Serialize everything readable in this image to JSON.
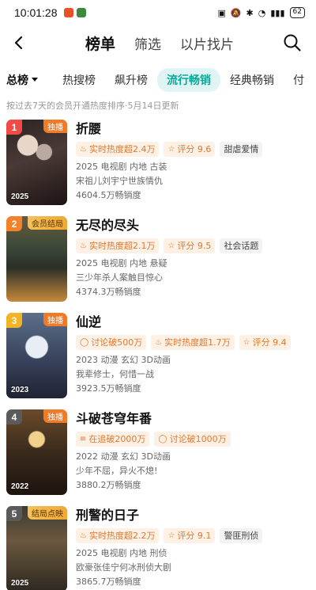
{
  "status": {
    "time": "10:01:28",
    "battery": "62"
  },
  "nav": {
    "tabs": [
      "榜单",
      "筛选",
      "以片找片"
    ],
    "active_index": 0
  },
  "categories": {
    "dropdown_label": "总榜",
    "items": [
      "热搜榜",
      "飙升榜",
      "流行畅销",
      "经典畅销",
      "付"
    ],
    "active_index": 2
  },
  "subtitle": "按过去7天的会员开通热度排序·5月14日更新",
  "items": [
    {
      "rank": "1",
      "badge": "独播",
      "year": "2025",
      "title": "折腰",
      "tags": [
        {
          "text": "实时热度超2.4万",
          "type": "hot",
          "icon": "flame-icon"
        },
        {
          "text": "评分 9.6",
          "type": "hot",
          "icon": "star-icon"
        },
        {
          "text": "甜虐爱情",
          "type": "plain",
          "icon": ""
        }
      ],
      "meta": "2025 电视剧 内地 古装",
      "desc": "宋祖儿刘宇宁世族情仇",
      "sales": "4604.5万畅销度"
    },
    {
      "rank": "2",
      "badge": "会员结局",
      "year": "",
      "title": "无尽的尽头",
      "tags": [
        {
          "text": "实时热度超2.1万",
          "type": "hot",
          "icon": "flame-icon"
        },
        {
          "text": "评分 9.5",
          "type": "hot",
          "icon": "star-icon"
        },
        {
          "text": "社会话题",
          "type": "plain",
          "icon": ""
        }
      ],
      "meta": "2025 电视剧 内地 悬疑",
      "desc": "三少年杀人案触目惊心",
      "sales": "4374.3万畅销度"
    },
    {
      "rank": "3",
      "badge": "独播",
      "year": "2023",
      "title": "仙逆",
      "tags": [
        {
          "text": "讨论破500万",
          "type": "hot",
          "icon": "chat-icon"
        },
        {
          "text": "实时热度超1.7万",
          "type": "hot",
          "icon": "flame-icon"
        },
        {
          "text": "评分 9.4",
          "type": "hot",
          "icon": "star-icon"
        }
      ],
      "meta": "2023 动漫 玄幻 3D动画",
      "desc": "我辈修士，何惜一战",
      "sales": "3923.5万畅销度"
    },
    {
      "rank": "4",
      "badge": "独播",
      "year": "2022",
      "title": "斗破苍穹年番",
      "tags": [
        {
          "text": "在追破2000万",
          "type": "hot",
          "icon": "list-icon"
        },
        {
          "text": "讨论破1000万",
          "type": "hot",
          "icon": "chat-icon"
        }
      ],
      "meta": "2022 动漫 玄幻 3D动画",
      "desc": "少年不屈，异火不熄!",
      "sales": "3880.2万畅销度"
    },
    {
      "rank": "5",
      "badge": "结局点映",
      "year": "2025",
      "title": "刑警的日子",
      "tags": [
        {
          "text": "实时热度超2.2万",
          "type": "hot",
          "icon": "flame-icon"
        },
        {
          "text": "评分 9.1",
          "type": "hot",
          "icon": "star-icon"
        },
        {
          "text": "警匪刑侦",
          "type": "plain",
          "icon": ""
        }
      ],
      "meta": "2025 电视剧 内地 刑侦",
      "desc": "欧豪张佳宁何冰刑侦大剧",
      "sales": "3865.7万畅销度"
    }
  ],
  "colors": {
    "accent": "#0aa99a",
    "hot": "#e0782c"
  }
}
